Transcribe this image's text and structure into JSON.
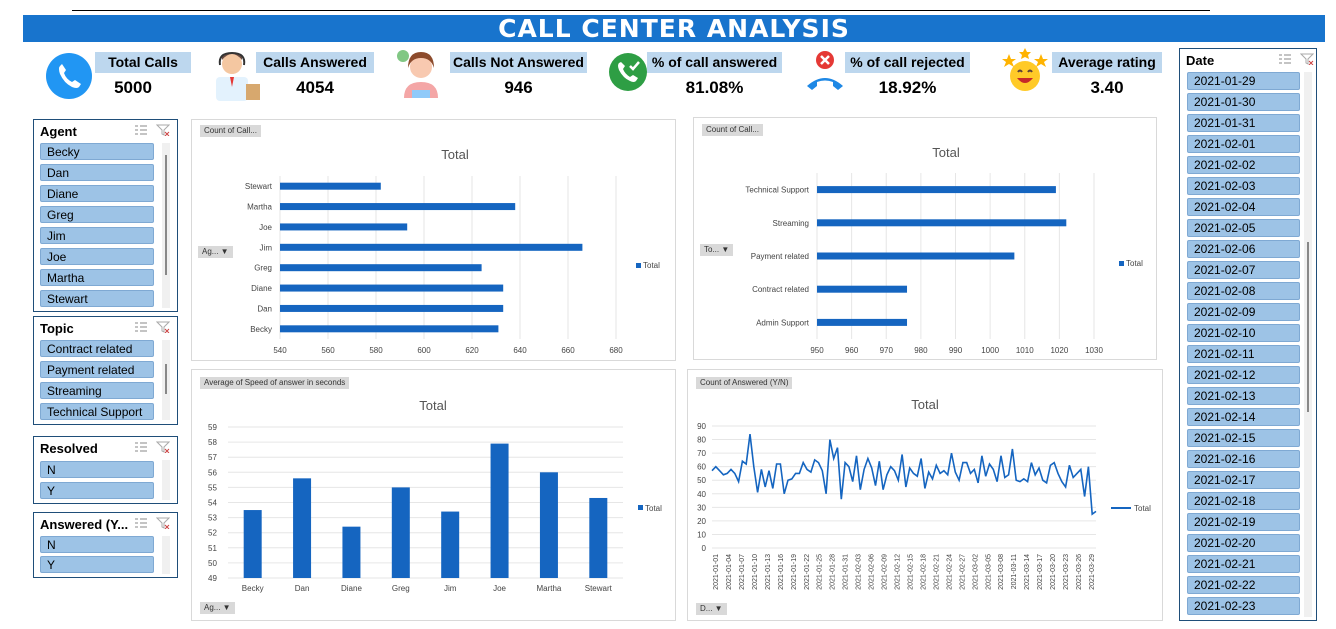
{
  "title": "CALL CENTER ANALYSIS",
  "kpis": [
    {
      "label": "Total Calls",
      "value": "5000",
      "icon": "phone-icon"
    },
    {
      "label": "Calls Answered",
      "value": "4054",
      "icon": "agent-icon"
    },
    {
      "label": "Calls Not Answered",
      "value": "946",
      "icon": "operator-icon"
    },
    {
      "label": "% of call answered",
      "value": "81.08%",
      "icon": "call-accepted-icon"
    },
    {
      "label": "% of call rejected",
      "value": "18.92%",
      "icon": "call-rejected-icon"
    },
    {
      "label": "Average rating",
      "value": "3.40",
      "icon": "star-smiley-icon"
    }
  ],
  "slicers": {
    "agent": {
      "title": "Agent",
      "items": [
        "Becky",
        "Dan",
        "Diane",
        "Greg",
        "Jim",
        "Joe",
        "Martha",
        "Stewart"
      ]
    },
    "topic": {
      "title": "Topic",
      "items": [
        "Contract related",
        "Payment related",
        "Streaming",
        "Technical Support"
      ]
    },
    "resolved": {
      "title": "Resolved",
      "items": [
        "N",
        "Y"
      ]
    },
    "answered": {
      "title": "Answered (Y...",
      "items": [
        "N",
        "Y"
      ]
    },
    "date": {
      "title": "Date",
      "items": [
        "2021-01-29",
        "2021-01-30",
        "2021-01-31",
        "2021-02-01",
        "2021-02-02",
        "2021-02-03",
        "2021-02-04",
        "2021-02-05",
        "2021-02-06",
        "2021-02-07",
        "2021-02-08",
        "2021-02-09",
        "2021-02-10",
        "2021-02-11",
        "2021-02-12",
        "2021-02-13",
        "2021-02-14",
        "2021-02-15",
        "2021-02-16",
        "2021-02-17",
        "2021-02-18",
        "2021-02-19",
        "2021-02-20",
        "2021-02-21",
        "2021-02-22",
        "2021-02-23"
      ]
    }
  },
  "colors": {
    "accent": "#1874cd",
    "label_bg": "#bdd7ee",
    "slicer_item": "#9dc3e6",
    "series": "#1565c0"
  },
  "chart_data": [
    {
      "type": "bar",
      "orientation": "horizontal",
      "field_chip": "Count of Call...",
      "axis_chip": "Ag...",
      "title": "Total",
      "legend": "Total",
      "legend_position": "right",
      "categories": [
        "Becky",
        "Dan",
        "Diane",
        "Greg",
        "Jim",
        "Joe",
        "Martha",
        "Stewart"
      ],
      "values": [
        631,
        633,
        633,
        624,
        666,
        593,
        638,
        582
      ],
      "xlim": [
        540,
        680
      ],
      "ticks": [
        540,
        560,
        580,
        600,
        620,
        640,
        660,
        680
      ],
      "grid": true
    },
    {
      "type": "bar",
      "orientation": "horizontal",
      "field_chip": "Count of Call...",
      "axis_chip": "To...",
      "title": "Total",
      "legend": "Total",
      "legend_position": "right",
      "categories": [
        "Admin Support",
        "Contract related",
        "Payment related",
        "Streaming",
        "Technical Support"
      ],
      "values": [
        976,
        976,
        1007,
        1022,
        1019
      ],
      "xlim": [
        950,
        1030
      ],
      "ticks": [
        950,
        960,
        970,
        980,
        990,
        1000,
        1010,
        1020,
        1030
      ],
      "grid": true
    },
    {
      "type": "bar",
      "orientation": "vertical",
      "field_chip": "Average of Speed of answer in seconds",
      "axis_chip": "Ag...",
      "title": "Total",
      "legend": "Total",
      "legend_position": "right",
      "categories": [
        "Becky",
        "Dan",
        "Diane",
        "Greg",
        "Jim",
        "Joe",
        "Martha",
        "Stewart"
      ],
      "values": [
        53.5,
        55.6,
        52.4,
        55.0,
        53.4,
        57.9,
        56.0,
        54.3
      ],
      "ylim": [
        49,
        59
      ],
      "ticks": [
        49,
        50,
        51,
        52,
        53,
        54,
        55,
        56,
        57,
        58,
        59
      ],
      "grid": true
    },
    {
      "type": "line",
      "field_chip": "Count of Answered (Y/N)",
      "axis_chip": "D...",
      "title": "Total",
      "legend": "Total",
      "legend_position": "right",
      "ylim": [
        0,
        90
      ],
      "ticks": [
        0,
        10,
        20,
        30,
        40,
        50,
        60,
        70,
        80,
        90
      ],
      "x_labels": [
        "2021-01-01",
        "2021-01-04",
        "2021-01-07",
        "2021-01-10",
        "2021-01-13",
        "2021-01-16",
        "2021-01-19",
        "2021-01-22",
        "2021-01-25",
        "2021-01-28",
        "2021-01-31",
        "2021-02-03",
        "2021-02-06",
        "2021-02-09",
        "2021-02-12",
        "2021-02-15",
        "2021-02-18",
        "2021-02-21",
        "2021-02-24",
        "2021-02-27",
        "2021-03-02",
        "2021-03-05",
        "2021-03-08",
        "2021-03-11",
        "2021-03-14",
        "2021-03-17",
        "2021-03-20",
        "2021-03-23",
        "2021-03-26",
        "2021-03-29"
      ],
      "values": [
        57,
        60,
        57,
        54,
        55,
        58,
        55,
        49,
        64,
        62,
        84,
        60,
        41,
        58,
        45,
        57,
        44,
        62,
        62,
        40,
        50,
        51,
        55,
        55,
        63,
        58,
        56,
        65,
        63,
        57,
        40,
        80,
        66,
        74,
        36,
        63,
        60,
        49,
        68,
        43,
        58,
        66,
        59,
        46,
        64,
        43,
        54,
        60,
        57,
        50,
        69,
        45,
        59,
        55,
        53,
        66,
        44,
        56,
        51,
        61,
        55,
        57,
        54,
        70,
        56,
        50,
        63,
        63,
        55,
        58,
        48,
        68,
        53,
        62,
        58,
        49,
        68,
        52,
        54,
        73,
        50,
        49,
        51,
        49,
        63,
        54,
        59,
        50,
        48,
        61,
        63,
        55,
        49,
        45,
        61,
        52,
        55,
        58,
        38,
        60,
        25,
        27
      ]
    }
  ]
}
